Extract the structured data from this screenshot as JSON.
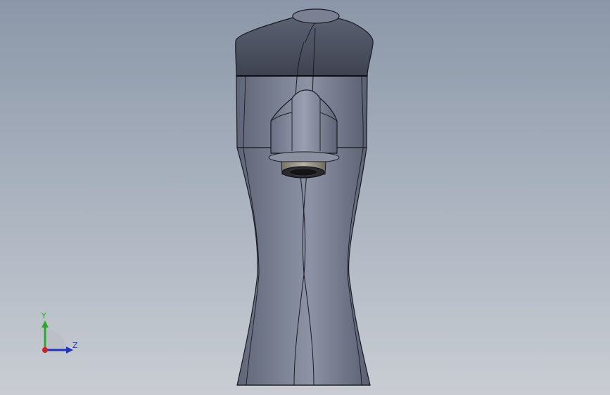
{
  "viewport": {
    "background_top": "#8b97a8",
    "background_bottom": "#c9cdd3"
  },
  "model": {
    "body_color": "#6f7689",
    "edge_color": "#1a1a22",
    "thread_color": "#9a958a"
  },
  "triad": {
    "y_label": "Y",
    "z_label": "Z",
    "y_color": "#2fa52f",
    "z_color": "#2233bb",
    "x_color": "#cc2222"
  }
}
